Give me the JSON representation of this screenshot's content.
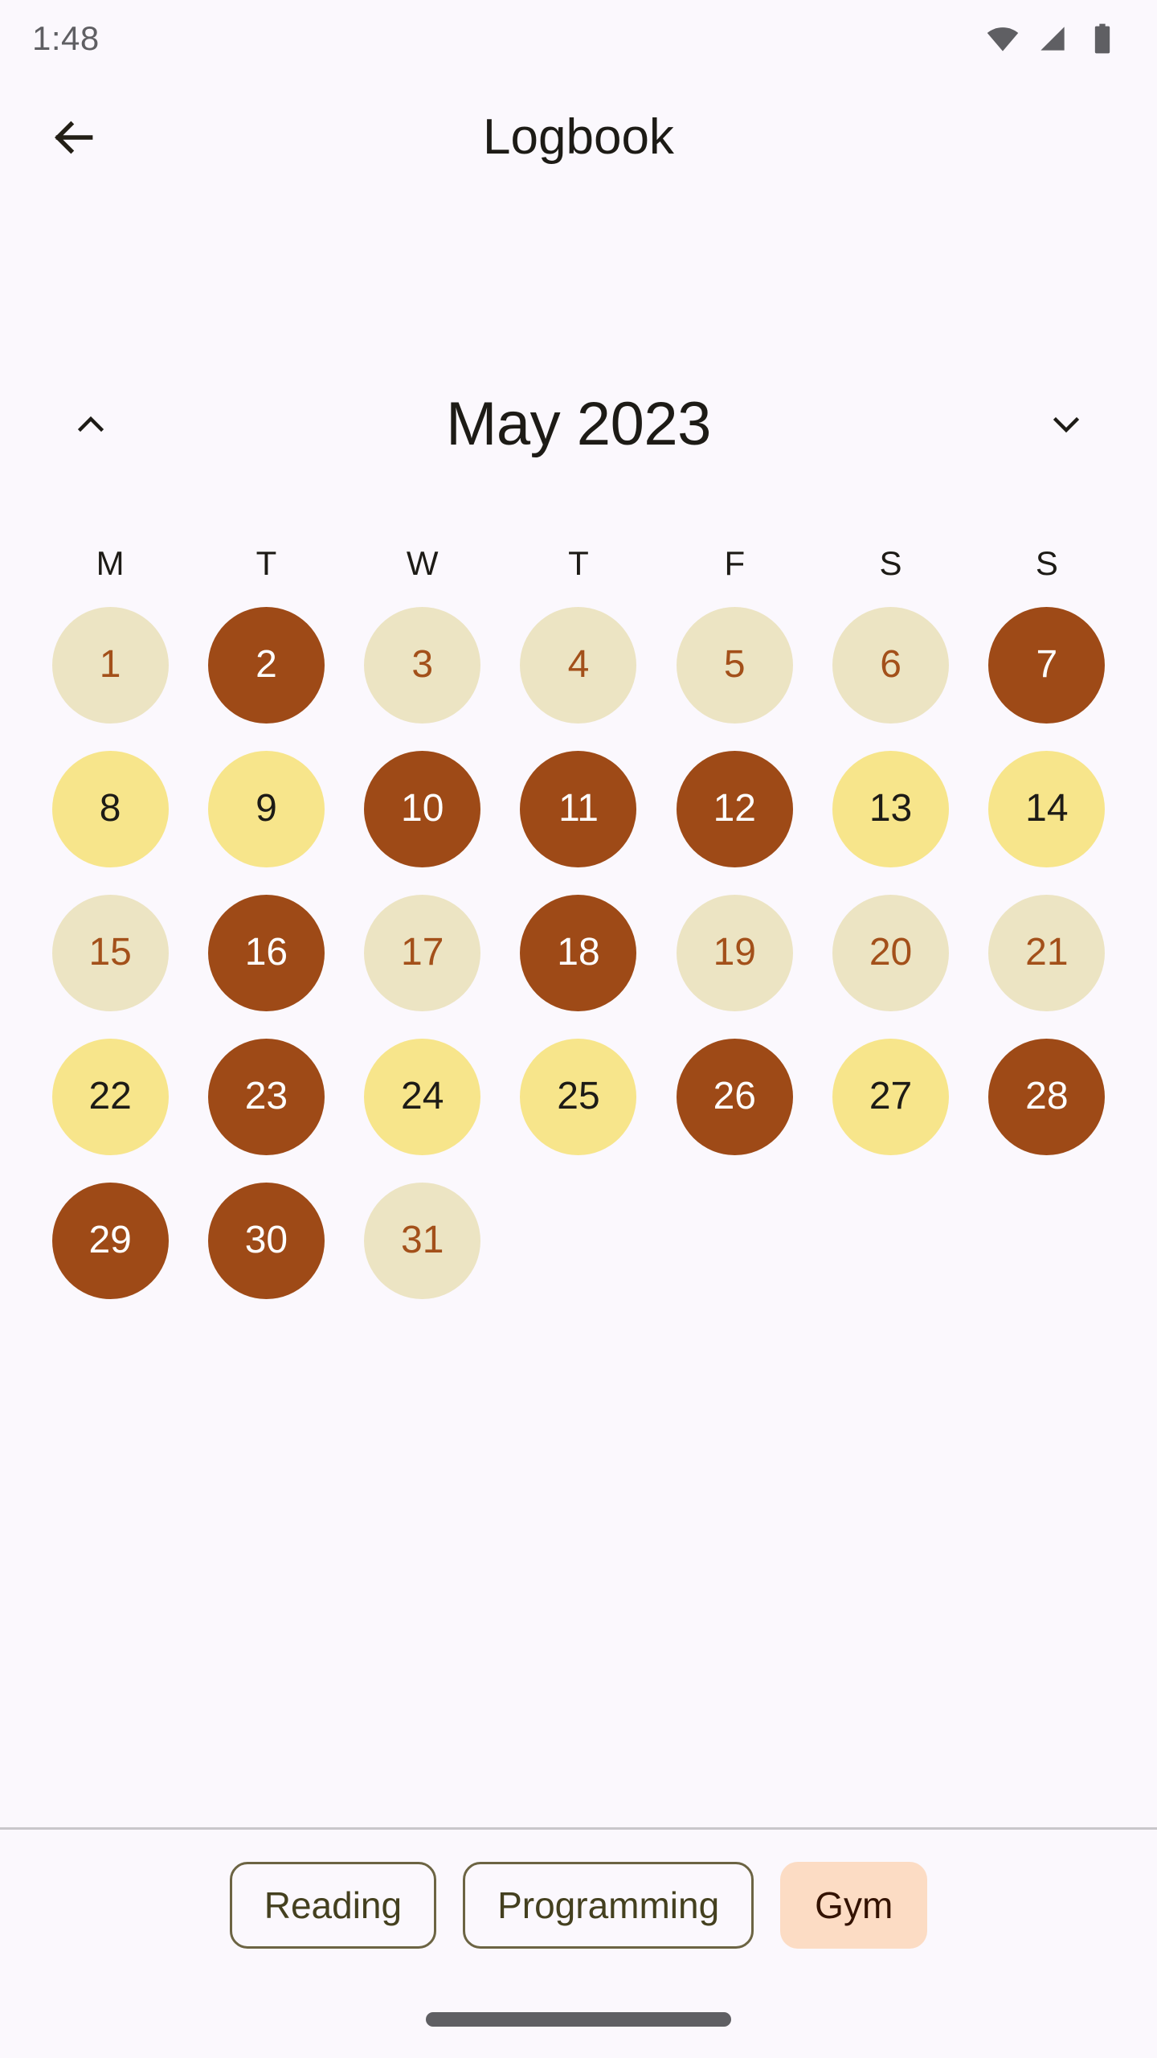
{
  "status_bar": {
    "time": "1:48",
    "icons": [
      "wifi-icon",
      "cellular-signal-icon",
      "battery-icon"
    ]
  },
  "app_bar": {
    "back_icon": "arrow-left-icon",
    "title": "Logbook"
  },
  "month_header": {
    "prev_icon": "chevron-up-icon",
    "next_icon": "chevron-down-icon",
    "label": "May 2023"
  },
  "calendar": {
    "weekdays": [
      "M",
      "T",
      "W",
      "T",
      "F",
      "S",
      "S"
    ],
    "colors": {
      "none": "#ece4c3",
      "none_text": "#a3501a",
      "low": "#f7e58b",
      "low_text": "#1d1b16",
      "high": "#9e4a17",
      "high_text": "#ffffff"
    },
    "days": [
      {
        "label": "1",
        "level": "none"
      },
      {
        "label": "2",
        "level": "high"
      },
      {
        "label": "3",
        "level": "none"
      },
      {
        "label": "4",
        "level": "none"
      },
      {
        "label": "5",
        "level": "none"
      },
      {
        "label": "6",
        "level": "none"
      },
      {
        "label": "7",
        "level": "high"
      },
      {
        "label": "8",
        "level": "low"
      },
      {
        "label": "9",
        "level": "low"
      },
      {
        "label": "10",
        "level": "high"
      },
      {
        "label": "11",
        "level": "high"
      },
      {
        "label": "12",
        "level": "high"
      },
      {
        "label": "13",
        "level": "low"
      },
      {
        "label": "14",
        "level": "low"
      },
      {
        "label": "15",
        "level": "none"
      },
      {
        "label": "16",
        "level": "high"
      },
      {
        "label": "17",
        "level": "none"
      },
      {
        "label": "18",
        "level": "high"
      },
      {
        "label": "19",
        "level": "none"
      },
      {
        "label": "20",
        "level": "none"
      },
      {
        "label": "21",
        "level": "none"
      },
      {
        "label": "22",
        "level": "low"
      },
      {
        "label": "23",
        "level": "high"
      },
      {
        "label": "24",
        "level": "low"
      },
      {
        "label": "25",
        "level": "low"
      },
      {
        "label": "26",
        "level": "high"
      },
      {
        "label": "27",
        "level": "low"
      },
      {
        "label": "28",
        "level": "high"
      },
      {
        "label": "29",
        "level": "high"
      },
      {
        "label": "30",
        "level": "high"
      },
      {
        "label": "31",
        "level": "none"
      }
    ]
  },
  "chips": [
    {
      "label": "Reading",
      "selected": false
    },
    {
      "label": "Programming",
      "selected": false
    },
    {
      "label": "Gym",
      "selected": true
    }
  ],
  "nav_bar": {
    "gesture_handle": "home-gesture-pill"
  }
}
